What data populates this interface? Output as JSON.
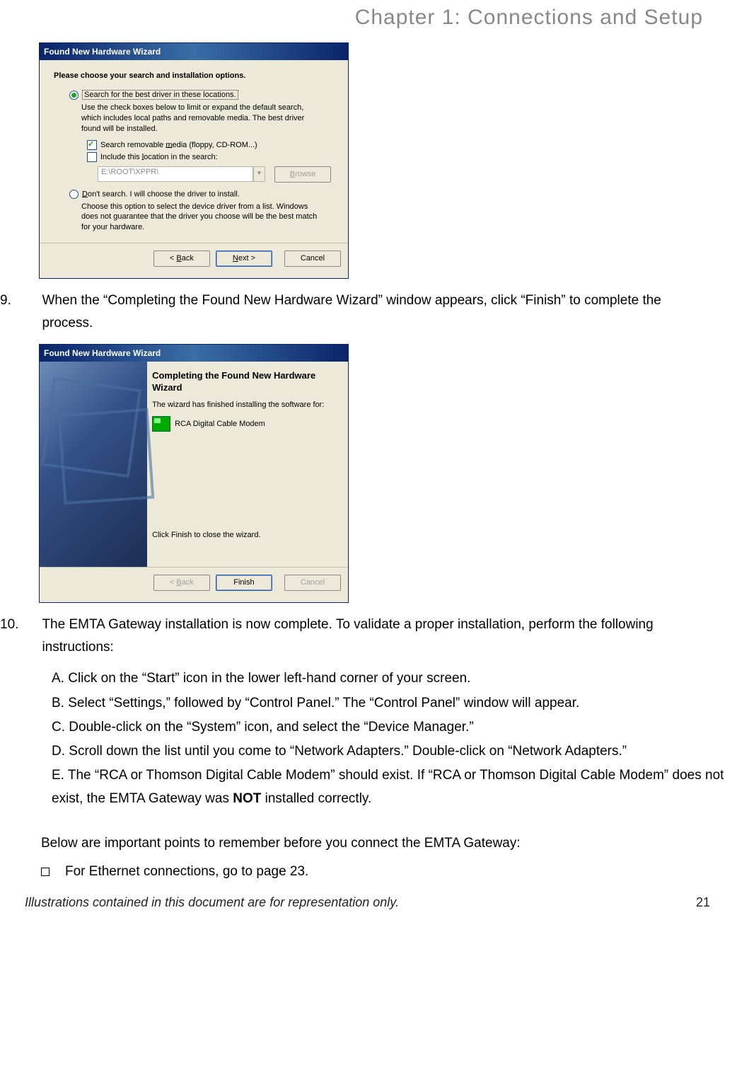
{
  "chapter_title": "Chapter 1: Connections and Setup",
  "dialog1": {
    "title": "Found New Hardware Wizard",
    "instruction": "Please choose your search and installation options.",
    "radio1": "Search for the best driver in these locations.",
    "radio1_desc": "Use the check boxes below to limit or expand the default search, which includes local paths and removable media. The best driver found will be installed.",
    "check1_pre": "Search removable ",
    "check1_u": "m",
    "check1_post": "edia (floppy, CD-ROM...)",
    "check2_pre": "Include this ",
    "check2_u": "l",
    "check2_post": "ocation in the search:",
    "path": "E:\\ROOT\\XPPR\\",
    "browse_u": "B",
    "browse_post": "rowse",
    "radio2_u": "D",
    "radio2_post": "on't search. I will choose the driver to install.",
    "radio2_desc": "Choose this option to select the device driver from a list.  Windows does not guarantee that the driver you choose will be the best match for your hardware.",
    "back": "< Back",
    "back_u": "B",
    "next": "Next >",
    "next_u": "N",
    "cancel": "Cancel"
  },
  "step9_num": "9.",
  "step9_text": "When the “Completing the Found New Hardware Wizard” window appears, click “Finish” to complete the process.",
  "dialog2": {
    "title": "Found New Hardware Wizard",
    "heading": "Completing the Found New Hardware Wizard",
    "subtext": "The wizard has finished installing the software for:",
    "device": "RCA Digital Cable Modem",
    "click_finish": "Click Finish to close the wizard.",
    "back": "< Back",
    "finish": "Finish",
    "cancel": "Cancel"
  },
  "step10_num": "10.",
  "step10_text": "The EMTA Gateway installation is now complete. To validate a proper installation, perform the following instructions:",
  "step10_a": "A. Click on the “Start” icon in the lower left-hand corner of your screen.",
  "step10_b": "B. Select “Settings,” followed by “Control Panel.” The “Control Panel” window will appear.",
  "step10_c": "C. Double-click on the “System” icon, and select the “Device Manager.”",
  "step10_d": "D. Scroll down the list until you come to “Network Adapters.” Double-click on “Network Adapters.”",
  "step10_e_pre": "E. The “RCA or Thomson Digital Cable Modem” should exist. If “RCA or Thomson Digital Cable Modem” does not exist, the EMTA Gateway was ",
  "step10_e_bold": "NOT",
  "step10_e_post": " installed correctly.",
  "note": "Below are important points to remember before you connect the EMTA Gateway:",
  "bullet1": "For Ethernet connections, go to page 23.",
  "footer_text": "Illustrations contained in this document are for representation only.",
  "page_number": "21"
}
